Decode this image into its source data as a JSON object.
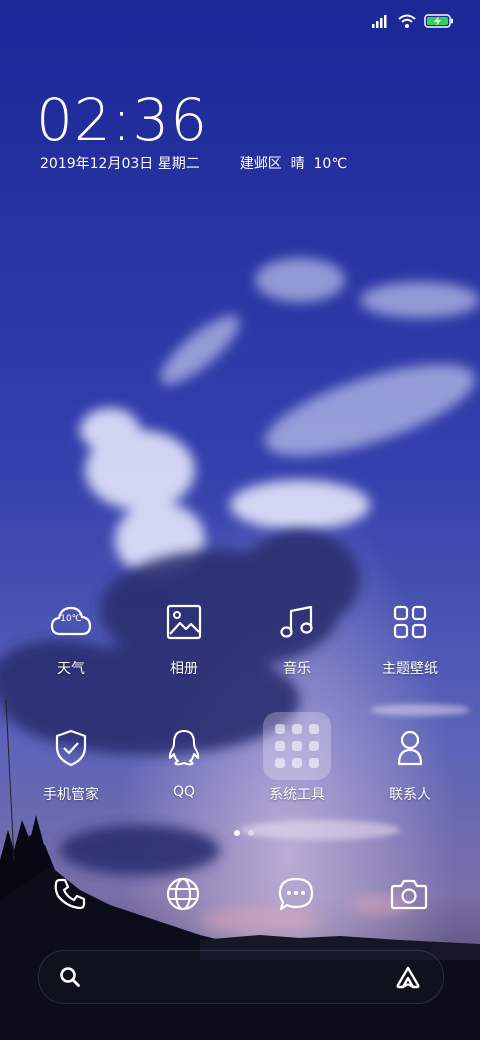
{
  "status_bar": {
    "icons": [
      "signal-icon",
      "wifi-icon",
      "battery-charging-icon"
    ]
  },
  "clock": {
    "time": "02:36",
    "date": "2019年12月03日 星期二",
    "location_weather": "建邺区  晴  10℃"
  },
  "apps": [
    {
      "label": "天气",
      "icon": "weather-cloud-icon",
      "icon_text": "10℃"
    },
    {
      "label": "相册",
      "icon": "gallery-icon"
    },
    {
      "label": "音乐",
      "icon": "music-note-icon"
    },
    {
      "label": "主题壁纸",
      "icon": "themes-grid-icon"
    },
    {
      "label": "手机管家",
      "icon": "security-shield-icon"
    },
    {
      "label": "QQ",
      "icon": "qq-penguin-icon"
    },
    {
      "label": "系统工具",
      "icon": "folder-icon"
    },
    {
      "label": "联系人",
      "icon": "contacts-icon"
    }
  ],
  "pager": {
    "pages": 2,
    "active": 1
  },
  "dock": [
    {
      "icon": "phone-icon"
    },
    {
      "icon": "browser-globe-icon"
    },
    {
      "icon": "messages-icon"
    },
    {
      "icon": "camera-icon"
    }
  ],
  "search_bar": {
    "left_icon": "search-icon",
    "right_icon": "assistant-icon"
  },
  "colors": {
    "sky_top": "#1d2a9a",
    "sky_mid": "#3342b0",
    "dark_ground": "#0c0f1c",
    "text": "#ffffff"
  }
}
